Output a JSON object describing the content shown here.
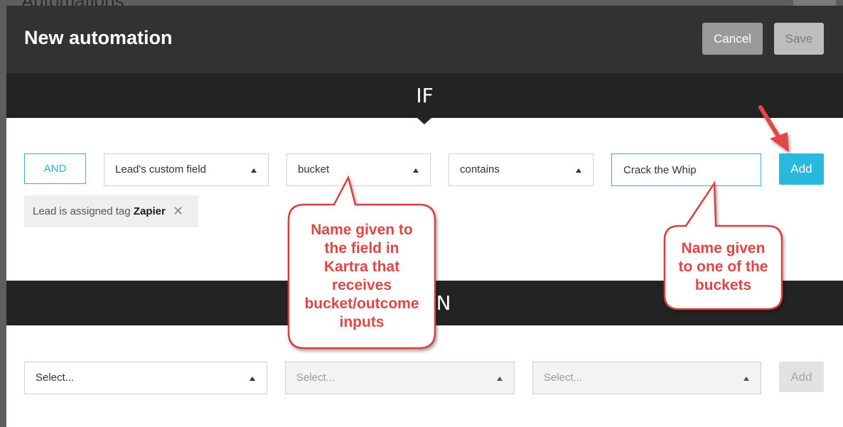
{
  "background": {
    "page_title": "Automations"
  },
  "modal": {
    "title": "New automation",
    "cancel_label": "Cancel",
    "save_label": "Save"
  },
  "if_section": {
    "label": "IF",
    "and_label": "AND",
    "field_select": "Lead's custom field",
    "name_select": "bucket",
    "operator_select": "contains",
    "value_input": "Crack the Whip",
    "add_label": "Add",
    "existing_condition": {
      "prefix": "Lead is assigned tag",
      "tag": "Zapier",
      "remove_glyph": "✕"
    }
  },
  "then_section": {
    "label": "N",
    "select_1": "Select...",
    "select_2": "Select...",
    "select_3": "Select...",
    "add_label": "Add"
  },
  "annotations": {
    "callout_1": [
      "Name given to",
      "the field in",
      "Kartra that",
      "receives",
      "bucket/outcome",
      "inputs"
    ],
    "callout_2": [
      "Name given",
      "to one of the",
      "buckets"
    ],
    "callout_color": "#e04646",
    "accent_color": "#29b8de"
  }
}
